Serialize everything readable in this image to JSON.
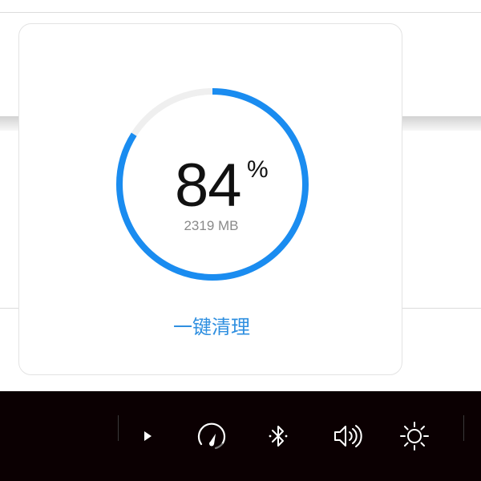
{
  "memory_card": {
    "percent_value": "84",
    "percent_sign": "%",
    "usage_text": "2319 MB",
    "usage_fraction": 0.84,
    "clean_label": "一键清理",
    "ring_color": "#1a8cf0",
    "track_color": "#efefef",
    "button_color": "#2f8fe0"
  },
  "system_bar": {
    "background": "#0b0002",
    "icons": [
      "play-icon",
      "speedometer-icon",
      "bluetooth-icon",
      "volume-icon",
      "brightness-icon"
    ]
  }
}
